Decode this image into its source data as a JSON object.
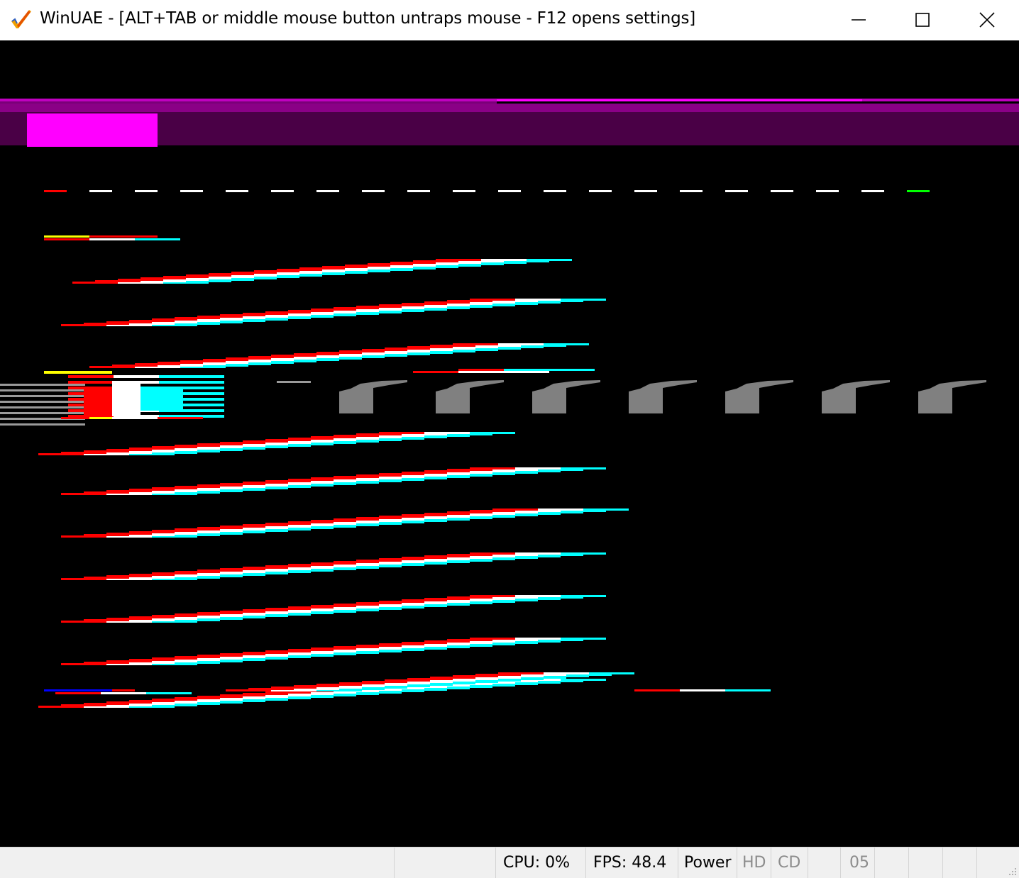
{
  "window": {
    "title": "WinUAE - [ALT+TAB or middle mouse button untraps mouse - F12 opens settings]",
    "app_icon": "winuae-checkmark-icon",
    "controls": {
      "minimize": "minimize-icon",
      "maximize": "maximize-icon",
      "close": "close-icon"
    }
  },
  "colors": {
    "magenta": "#ff00ff",
    "dark_purple": "#4a0046",
    "red": "#ff0000",
    "white": "#ffffff",
    "cyan": "#00ffff",
    "yellow": "#ffff00",
    "green": "#00ff00",
    "blue": "#0000ff",
    "grey": "#808080"
  },
  "statusbar": {
    "cpu": "CPU: 0%",
    "fps": "FPS: 48.4",
    "power": "Power",
    "hd": "HD",
    "cd": "CD",
    "drive": "05"
  }
}
